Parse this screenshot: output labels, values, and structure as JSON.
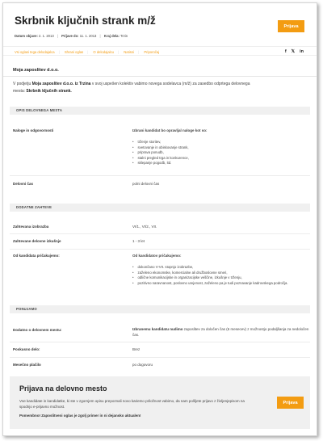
{
  "header": {
    "title": "Skrbnik ključnih strank m/ž",
    "published_label": "Datum objave:",
    "published_value": "2. 1. 2013",
    "deadline_label": "Prijave do:",
    "deadline_value": "11. 1. 2013",
    "worktime_label": "Kraj dela:",
    "worktime_value": "Trzin",
    "apply_label": "Prijava"
  },
  "nav": {
    "links": [
      "Vsi oglasi tega delodajalca",
      "Shrani oglas",
      "O delodajalcu",
      "Natisni",
      "Priporočaj"
    ],
    "social": [
      "f",
      "𝕏",
      "in"
    ]
  },
  "company": "Moja zaposlitev d.o.o.",
  "intro": {
    "p1": "V podjetju ",
    "company": "Moja zaposlitev d.o.o. iz Trzina",
    "p2": " v svoj uspešen kolektiv vabimo novega sodelavca (m/ž) za zasedbo odprtega delovnega mesta: ",
    "position": "Skrbnik ključnih strank."
  },
  "sections": {
    "opis": "OPIS DELOVNEGA MESTA",
    "zahteve": "DODATNE ZAHTEVE",
    "ponujamo": "PONUJAMO"
  },
  "opis": {
    "naloge_label": "Naloge in odgovornosti",
    "naloge_intro": "Izbrani kandidat bo opravljal naloge kot so:",
    "naloge_items": [
      "trženje storitev,",
      "svetovanje in obiskovanje strank,",
      "priprava ponudb,",
      "stalni pregled trga in konkurence,",
      "sklepanje pogodb, itd."
    ],
    "cas_label": "Delovni čas",
    "cas_value": "polni delovni čas"
  },
  "zahteve": {
    "izobrazba_label": "Zahtevana izobrazba",
    "izobrazba_value": "VI/1., VI/2., VII.",
    "izkusnje_label": "Zahtevane delovne izkušnje",
    "izkusnje_value": "1 - 3 let",
    "pricakujemo_label": "Od kandidata pričakujemo:",
    "pricakujemo_intro": "Od kandidatov pričakujemo:",
    "pricakujemo_items": [
      "dokončano V-VII. stopnjo izobrazbe,",
      "zaželeno ekonomske, komercialne ali družboslovne smeri,",
      "odlične komunikacijske in organizacijske veščine, izkušnje v trženju,",
      "pozitivno naravnanost, poslovno urejenost, zaželeno pa je tudi poznavanje kadrovskega področja."
    ]
  },
  "ponujamo": {
    "dodatno_label": "Dodatno o delovnem mestu:",
    "dodatno_bold": "Izbranemu kandidatu nudimo",
    "dodatno_text": " zaposlitev za določen čas (6 mesecev) z možnostjo podaljšanja za nedoločen čas.",
    "poskusno_label": "Poskusno delo:",
    "poskusno_value": "Brez",
    "placilo_label": "Mesečno plačilo",
    "placilo_value": "po dogovoru"
  },
  "footer": {
    "title": "Prijava na delovno mesto",
    "text": "Vse kandidate in kandidatke, ki ste v zgornjem opisu prepoznali novo kariemo priložnost vabimo, da nam pošljete prijavo z življenjepisom na spodnjo e-prijavno možnost.",
    "note": "Pomembno! Zaposlitveni oglas je zgolj primer in ni dejansko aktualen!",
    "apply_label": "Prijava"
  },
  "colors": {
    "accent": "#f39c12",
    "section_bg": "#f0f0f0"
  }
}
